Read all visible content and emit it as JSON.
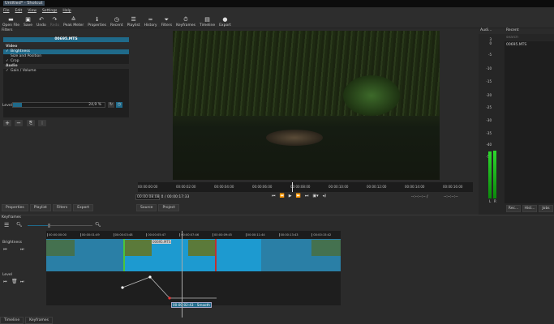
{
  "window": {
    "title": "Untitled* - Shotcut"
  },
  "menu": [
    "File",
    "Edit",
    "View",
    "Settings",
    "Help"
  ],
  "toolbar": [
    {
      "label": "Open File",
      "icon": "folder-icon",
      "glyph": "▬"
    },
    {
      "label": "Save",
      "icon": "save-icon",
      "glyph": "▣"
    },
    {
      "label": "Undo",
      "icon": "undo-icon",
      "glyph": "↶"
    },
    {
      "label": "Redo",
      "icon": "redo-icon",
      "glyph": "↷",
      "disabled": true
    },
    {
      "label": "Peak Meter",
      "icon": "meter-icon",
      "glyph": "≙"
    },
    {
      "label": "Properties",
      "icon": "info-icon",
      "glyph": "ℹ"
    },
    {
      "label": "Recent",
      "icon": "clock-icon",
      "glyph": "◷"
    },
    {
      "label": "Playlist",
      "icon": "list-icon",
      "glyph": "☰"
    },
    {
      "label": "History",
      "icon": "history-icon",
      "glyph": "≂"
    },
    {
      "label": "Filters",
      "icon": "filter-icon",
      "glyph": "⏷"
    },
    {
      "label": "Keyframes",
      "icon": "stopwatch-icon",
      "glyph": "⏱"
    },
    {
      "label": "Timeline",
      "icon": "timeline-icon",
      "glyph": "▤"
    },
    {
      "label": "Export",
      "icon": "export-icon",
      "glyph": "●"
    }
  ],
  "filters": {
    "title": "Filters",
    "clip": "00695.MTS",
    "items": [
      {
        "label": "Video",
        "category": true
      },
      {
        "label": "Brightness",
        "checked": true,
        "selected": true
      },
      {
        "label": "Size and Position",
        "checked": false
      },
      {
        "label": "Crop",
        "checked": true
      },
      {
        "label": "Audio",
        "category": true
      },
      {
        "label": "Gain / Volume",
        "checked": true
      }
    ],
    "level_label": "Level",
    "level_value": "24,9 %",
    "level_fraction": 0.249
  },
  "left_tabs": [
    "Properties",
    "Playlist",
    "Filters",
    "Export"
  ],
  "player": {
    "ticks": [
      "00:00:00:00",
      "00:00:02:00",
      "00:00:04:00",
      "00:00:06:00",
      "00:00:08:00",
      "00:00:10:00",
      "00:00:12:00",
      "00:00:14:00",
      "00:00:16:00"
    ],
    "position": "00:00:08:08",
    "duration": "/ 00:00:17:33",
    "in_point": "--:--:--:-- /",
    "out_point": "--:--:--:--",
    "tabs": [
      "Source",
      "Project"
    ]
  },
  "audio": {
    "title": "Audi...",
    "scale": [
      "3",
      "0",
      "-5",
      "-10",
      "-15",
      "-20",
      "-25",
      "-30",
      "-35",
      "-40",
      "-50"
    ],
    "channels": [
      "L",
      "R"
    ],
    "level_db": -30
  },
  "recent": {
    "title": "Recent",
    "search_placeholder": "search",
    "items": [
      "00695.MTS"
    ],
    "tabs": [
      "Rec...",
      "Hist...",
      "Jobs"
    ]
  },
  "keyframes": {
    "title": "Keyframes",
    "ticks": [
      "00:00:00:00",
      "00:00:01:49",
      "00:00:03:48",
      "00:00:05:47",
      "00:00:07:46",
      "00:00:09:45",
      "00:00:11:44",
      "00:00:13:43",
      "00:00:15:42"
    ],
    "tracks": [
      {
        "label": "Brightness"
      },
      {
        "label": "Level"
      }
    ],
    "clip_label": "00695.MTS",
    "tooltip": "00:00:02:43 - Smooth"
  },
  "bottom_tabs": [
    "Timeline",
    "Keyframes"
  ],
  "colors": {
    "accent": "#1f6a8a",
    "clip": "#2a8ab0",
    "in_marker": "#4cc43a",
    "out_marker": "#c03030",
    "meter": "#19b319"
  }
}
